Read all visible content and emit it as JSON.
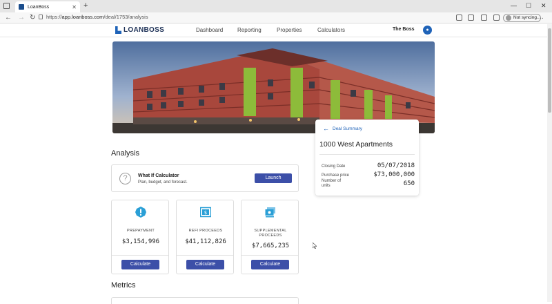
{
  "browser": {
    "tab_title": "LoanBoss",
    "url_scheme": "https://",
    "url_host": "app.loanboss.com",
    "url_path": "/deal/1753/analysis",
    "profile_label": "Not syncing"
  },
  "nav": {
    "brand": "LOANBOSS",
    "links": [
      "Dashboard",
      "Reporting",
      "Properties",
      "Calculators"
    ],
    "user": "The Boss"
  },
  "deal": {
    "back_label": "Deal Summary",
    "title": "1000 West Apartments",
    "rows": [
      {
        "label": "Closing Date",
        "value": "05/07/2018"
      },
      {
        "label": "Purchase price",
        "value": "$73,000,000"
      },
      {
        "label": "Number of units",
        "value": "650"
      }
    ]
  },
  "analysis": {
    "heading": "Analysis",
    "whatif_title": "What If Calculator",
    "whatif_subtitle": "Plan, budget, and forecast.",
    "launch_label": "Launch",
    "cards": [
      {
        "label": "PREPAYMENT",
        "value": "$3,154,996",
        "button": "Calculate",
        "icon": "alert-icon"
      },
      {
        "label": "REFI PROCEEDS",
        "value": "$41,112,826",
        "button": "Calculate",
        "icon": "dollar-icon"
      },
      {
        "label": "SUPPLEMENTAL PROCEEDS",
        "value": "$7,665,235",
        "button": "Calculate",
        "icon": "cash-stack-icon"
      }
    ]
  },
  "metrics": {
    "heading": "Metrics"
  },
  "colors": {
    "brand": "#1f63b8",
    "button": "#3c4fa8",
    "icon_accent": "#2a9fd6"
  }
}
